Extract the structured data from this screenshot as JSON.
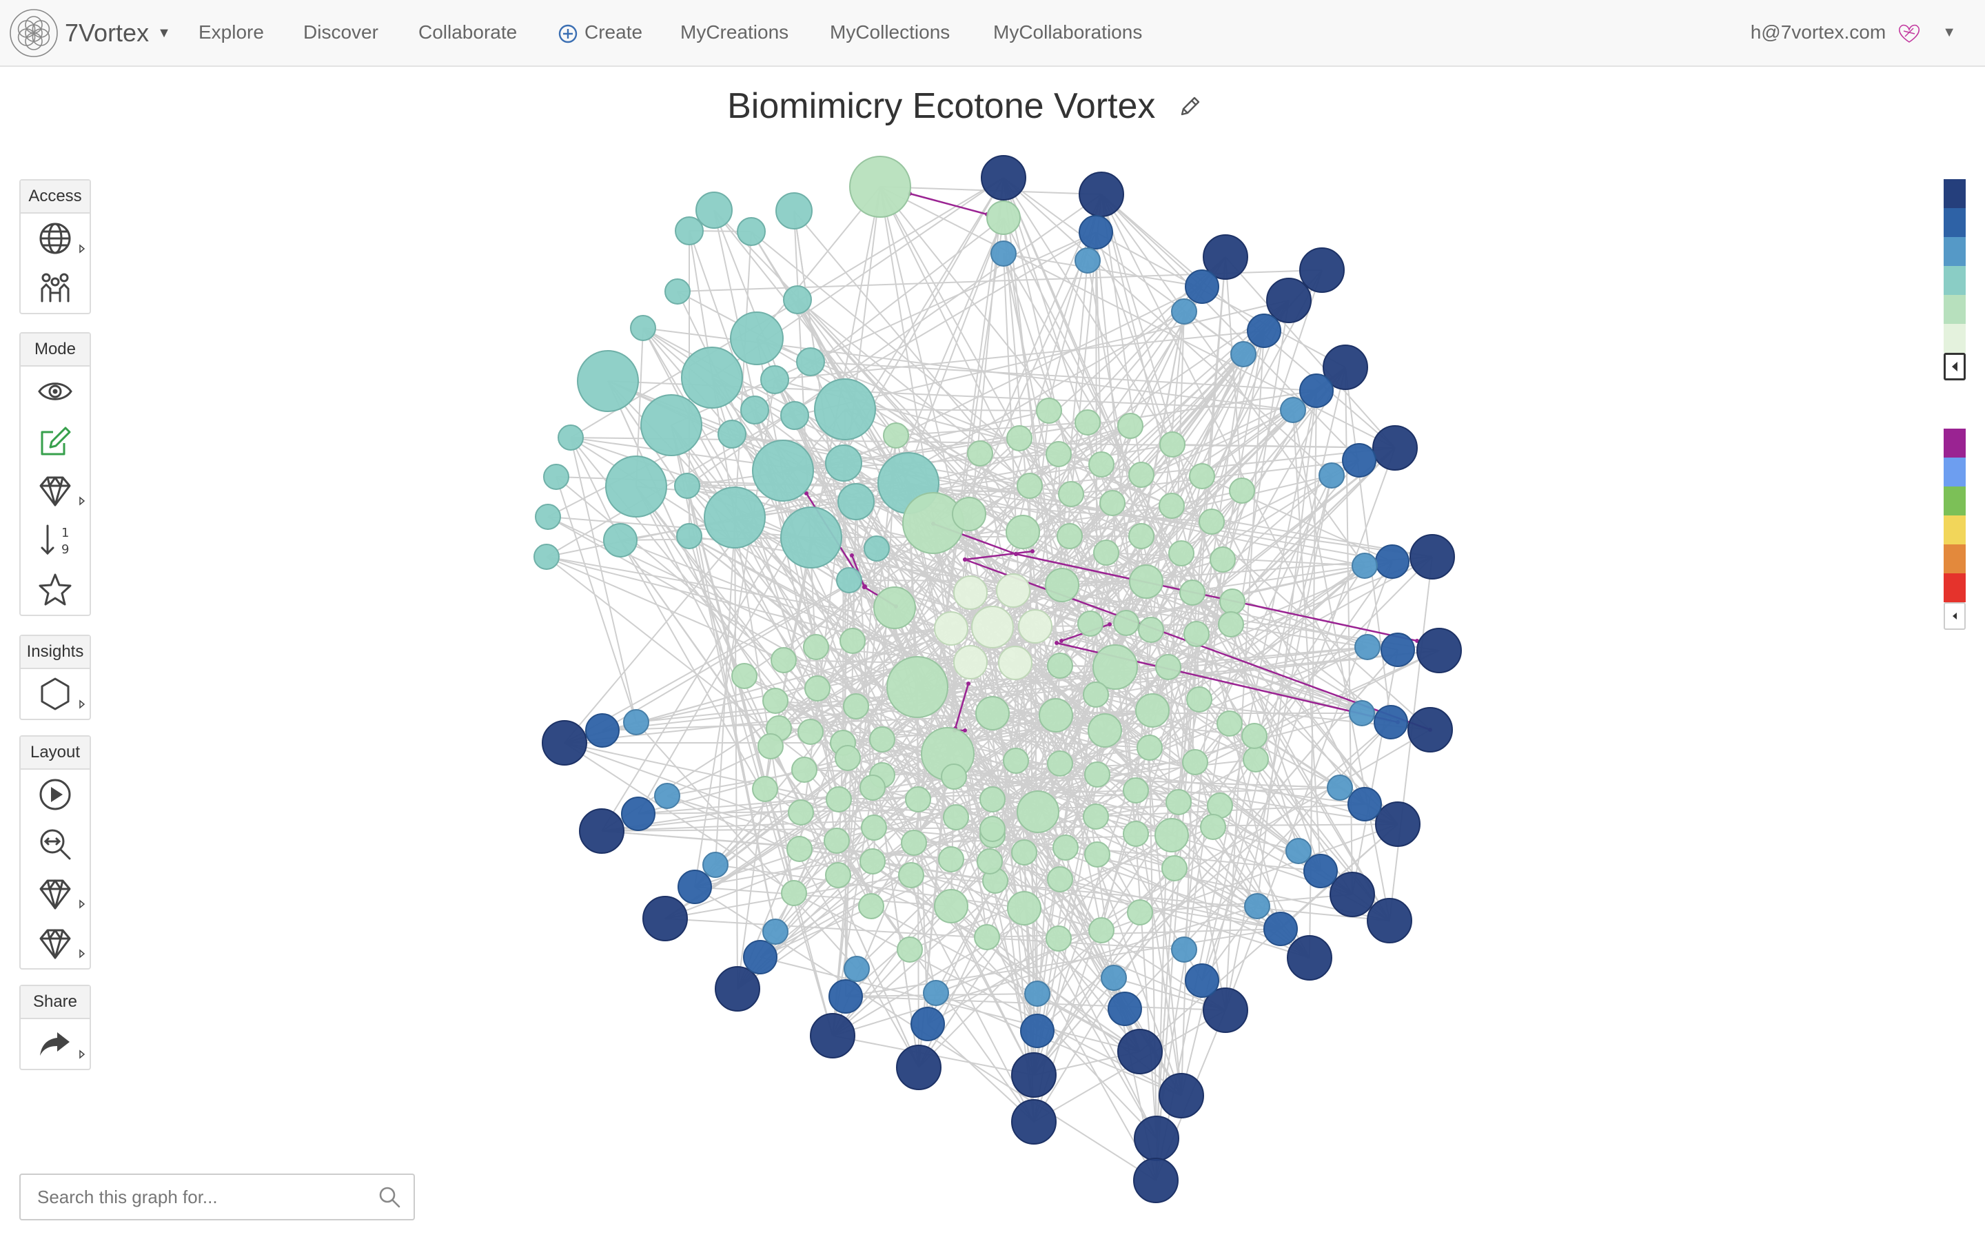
{
  "brand": {
    "name": "7Vortex"
  },
  "nav": {
    "items": [
      {
        "label": "Explore"
      },
      {
        "label": "Discover"
      },
      {
        "label": "Collaborate"
      },
      {
        "label": "Create"
      },
      {
        "label": "MyCreations"
      },
      {
        "label": "MyCollections"
      },
      {
        "label": "MyCollaborations"
      }
    ]
  },
  "user": {
    "email": "h@7vortex.com"
  },
  "graph": {
    "title": "Biomimicry Ecotone Vortex"
  },
  "toolbar": {
    "groups": [
      {
        "label": "Access",
        "buttons": [
          "globe-icon",
          "people-icon"
        ]
      },
      {
        "label": "Mode",
        "buttons": [
          "eye-icon",
          "edit-icon",
          "diamond-icon",
          "sort-numeric-icon",
          "star-icon"
        ]
      },
      {
        "label": "Insights",
        "buttons": [
          "hexagon-icon"
        ]
      },
      {
        "label": "Layout",
        "buttons": [
          "play-icon",
          "zoom-fit-icon",
          "diamond-icon",
          "diamond-icon"
        ]
      },
      {
        "label": "Share",
        "buttons": [
          "share-arrow-icon"
        ]
      }
    ]
  },
  "search": {
    "placeholder": "Search this graph for..."
  },
  "colors": {
    "navy": "#253f7c",
    "blue": "#2e62a6",
    "skyblue": "#5599c7",
    "teal": "#8acdc5",
    "mint": "#b7e0bd",
    "pale": "#e4f2dd",
    "edge": "#cfcfcf",
    "highlight": "#9a2392"
  },
  "legend": {
    "node_colors": [
      "#253f7c",
      "#2e62a6",
      "#5599c7",
      "#8acdc5",
      "#b7e0bd",
      "#e4f2dd"
    ],
    "edge_colors": [
      "#9a2392",
      "#6d9ef0",
      "#7cc057",
      "#f2d65a",
      "#e3893c",
      "#e5332c"
    ]
  }
}
